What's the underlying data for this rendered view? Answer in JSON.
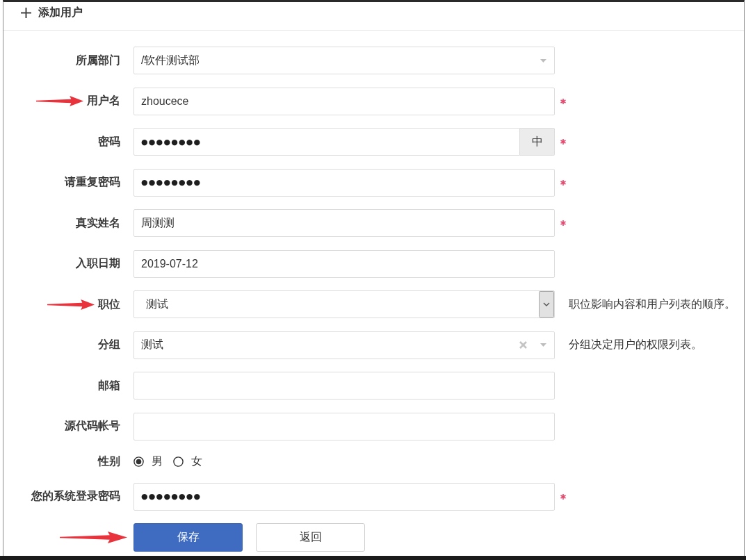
{
  "header": {
    "title": "添加用户"
  },
  "form": {
    "fields": [
      {
        "kind": "select",
        "label": "所属部门",
        "value": "/软件测试部",
        "required": false,
        "arrow": false
      },
      {
        "kind": "text",
        "label": "用户名",
        "value": "zhoucece",
        "required": true,
        "arrow": true
      },
      {
        "kind": "password",
        "label": "密码",
        "value": "●●●●●●●●",
        "addon": "中",
        "required": true,
        "arrow": false
      },
      {
        "kind": "password",
        "label": "请重复密码",
        "value": "●●●●●●●●",
        "required": true,
        "arrow": false
      },
      {
        "kind": "text",
        "label": "真实姓名",
        "value": "周测测",
        "required": true,
        "arrow": false
      },
      {
        "kind": "text",
        "label": "入职日期",
        "value": "2019-07-12",
        "required": false,
        "arrow": false
      },
      {
        "kind": "dropdown",
        "label": "职位",
        "value": "测试",
        "help": "职位影响内容和用户列表的顺序。",
        "required": false,
        "arrow": true
      },
      {
        "kind": "chosen",
        "label": "分组",
        "value": "测试",
        "help": "分组决定用户的权限列表。",
        "required": false,
        "arrow": false
      },
      {
        "kind": "text",
        "label": "邮箱",
        "required": false,
        "arrow": false
      },
      {
        "kind": "text",
        "label": "源代码帐号",
        "required": false,
        "arrow": false
      },
      {
        "kind": "radio",
        "label": "性别",
        "options": [
          {
            "label": "男",
            "selected": true
          },
          {
            "label": "女",
            "selected": false
          }
        ],
        "required": false,
        "arrow": false
      },
      {
        "kind": "password",
        "label": "您的系统登录密码",
        "value": "●●●●●●●●",
        "required": true,
        "arrow": false
      }
    ]
  },
  "actions": {
    "arrow": true,
    "buttons": [
      {
        "kind": "primary",
        "label": "保存"
      },
      {
        "kind": "default",
        "label": "返回"
      }
    ]
  }
}
